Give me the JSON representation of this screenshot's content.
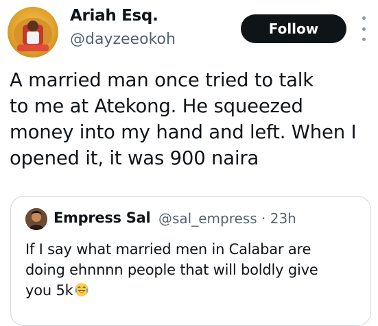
{
  "tweet": {
    "author": {
      "display_name": "Ariah Esq.",
      "handle": "@dayzeeokoh"
    },
    "follow_label": "Follow",
    "text_lines": [
      "A married man once tried to talk",
      "to me at Atekong. He squeezed",
      "money into my hand and left. When I",
      "opened it, it was 900 naira"
    ]
  },
  "quoted_tweet": {
    "author": {
      "display_name": "Empress Sal",
      "handle": "@sal_empress",
      "separator": " · ",
      "time": "23h"
    },
    "text_lines": [
      "If I say what married men in Calabar are",
      "doing ehnnnn people that will boldly give",
      "you 5k"
    ],
    "trailing_emoji": "face-with-tears-of-joy"
  },
  "icons": {
    "more": "more-vertical-icon"
  },
  "colors": {
    "text_primary": "#0f1419",
    "text_secondary": "#536471",
    "follow_bg": "#0f1419",
    "follow_text": "#ffffff",
    "quote_border": "#cfd9de"
  }
}
